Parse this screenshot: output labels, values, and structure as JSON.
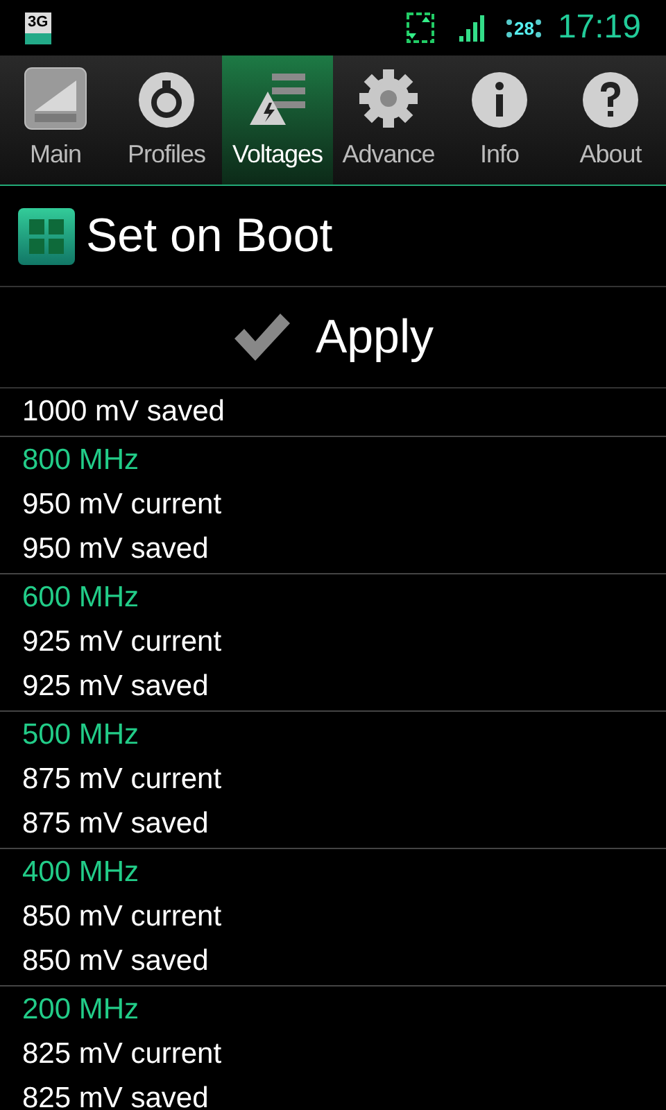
{
  "status_bar": {
    "network_badge": "3G",
    "battery": "28",
    "time": "17:19"
  },
  "tabs": [
    {
      "label": "Main",
      "kind": "main",
      "selected": false
    },
    {
      "label": "Profiles",
      "kind": "profiles",
      "selected": false
    },
    {
      "label": "Voltages",
      "kind": "voltages",
      "selected": true
    },
    {
      "label": "Advance",
      "kind": "advance",
      "selected": false
    },
    {
      "label": "Info",
      "kind": "info",
      "selected": false
    },
    {
      "label": "About",
      "kind": "about",
      "selected": false
    }
  ],
  "set_on_boot": {
    "label": "Set on Boot",
    "checked": true
  },
  "apply_button": {
    "label": "Apply"
  },
  "groups": [
    {
      "saved": "1000 mV saved"
    },
    {
      "frequency": "800 MHz",
      "current": "950 mV current",
      "saved": "950 mV saved"
    },
    {
      "frequency": "600 MHz",
      "current": "925 mV current",
      "saved": "925 mV saved"
    },
    {
      "frequency": "500 MHz",
      "current": "875 mV current",
      "saved": "875 mV saved"
    },
    {
      "frequency": "400 MHz",
      "current": "850 mV current",
      "saved": "850 mV saved"
    },
    {
      "frequency": "200 MHz",
      "current": "825 mV current",
      "saved": "825 mV saved"
    }
  ]
}
